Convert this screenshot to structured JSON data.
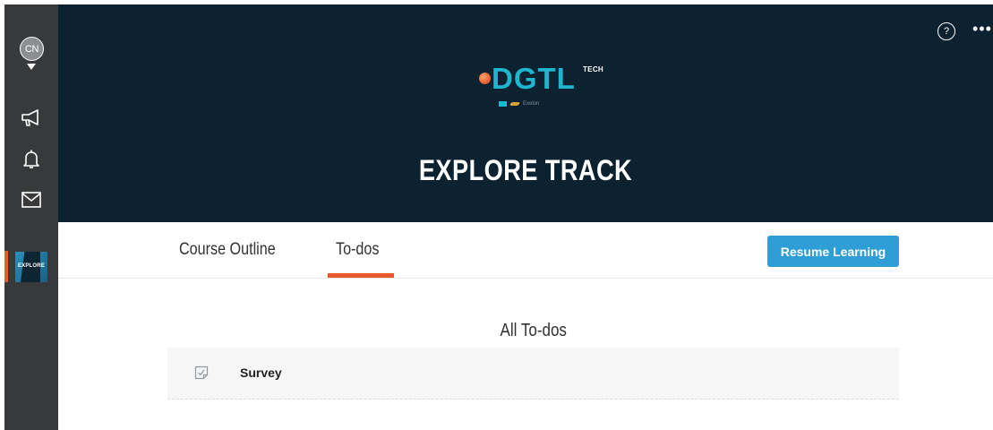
{
  "rail": {
    "avatar_initials": "CN",
    "items": [
      {
        "icon": "megaphone-icon",
        "label": "Announcements"
      },
      {
        "icon": "bell-icon",
        "label": "Notifications"
      },
      {
        "icon": "mail-icon",
        "label": "Messages"
      }
    ],
    "course": {
      "thumb_text": "EXPLORE"
    }
  },
  "header": {
    "logo": {
      "word": "DGTL",
      "superscript": "TECH",
      "partner": "Exelon"
    },
    "title": "EXPLORE TRACK",
    "help_label": "?",
    "more_label": "•••"
  },
  "tabs": {
    "items": [
      {
        "label": "Course Outline",
        "active": false
      },
      {
        "label": "To-dos",
        "active": true
      }
    ],
    "resume_label": "Resume Learning"
  },
  "todos": {
    "title": "All To-dos",
    "items": [
      {
        "icon": "survey-checklist-icon",
        "label": "Survey"
      }
    ]
  },
  "colors": {
    "rail_bg": "#37393b",
    "hero_bg": "#0c2231",
    "accent_orange": "#e8592b",
    "brand_cyan": "#1fb5cf",
    "button_blue": "#2f9ed6"
  }
}
